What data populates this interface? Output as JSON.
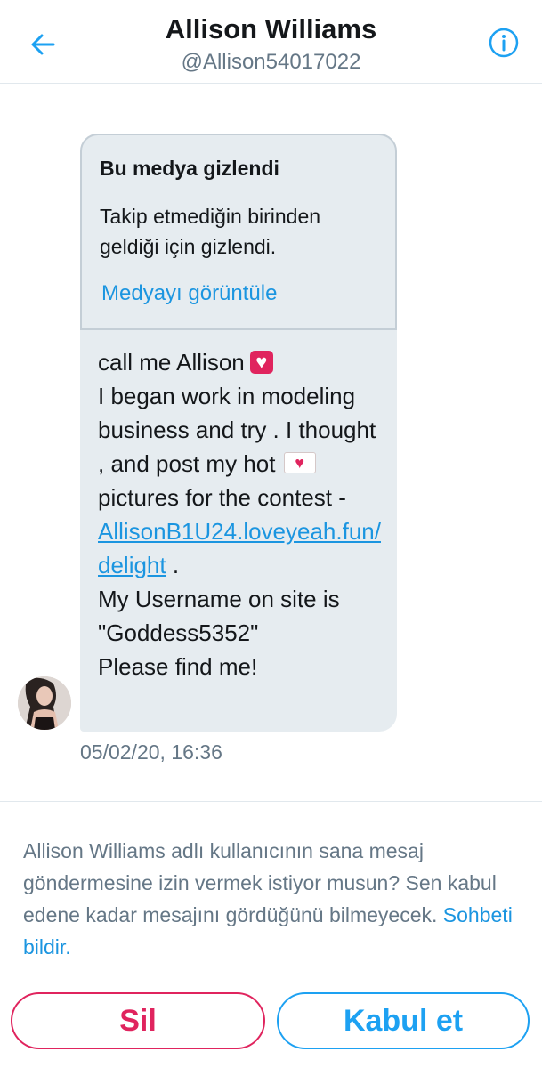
{
  "header": {
    "title": "Allison Williams",
    "handle": "@Allison54017022",
    "back_icon": "arrow-left-icon",
    "info_icon": "info-circle-icon"
  },
  "message": {
    "hidden_media": {
      "title": "Bu medya gizlendi",
      "description": "Takip etmediğin birinden geldiği için gizlendi.",
      "view_link": "Medyayı görüntüle"
    },
    "line1": "call me Allison",
    "line2": "I began work in modeling business and try   . I thought , and post my hot",
    "line3": "pictures for the contest -",
    "link": "AllisonB1U24.loveyeah.fun/delight",
    "line4": " .",
    "line5": "My Username on site is \"Goddess5352\"",
    "line6": "Please find me!",
    "timestamp": "05/02/20, 16:36",
    "heart_emoji": "red-heart-emoji",
    "letter_emoji": "love-letter-emoji"
  },
  "request": {
    "prompt": "Allison Williams adlı kullanıcının sana mesaj göndermesine izin vermek istiyor musun? Sen kabul edene kadar mesajını gördüğünü bilmeyecek.",
    "report_link": "Sohbeti bildir.",
    "delete_label": "Sil",
    "accept_label": "Kabul et"
  },
  "colors": {
    "accent": "#1da1f2",
    "link": "#1b95e0",
    "danger": "#e0245e",
    "bubble": "#e6ecf0",
    "secondary_text": "#657786"
  }
}
